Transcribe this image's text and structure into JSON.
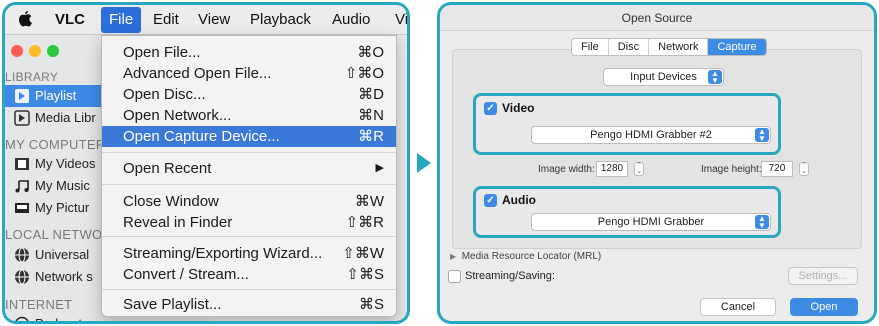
{
  "colors": {
    "accent": "#2aa7bf",
    "selection": "#3b79d9"
  },
  "menubar": {
    "items": [
      "VLC",
      "File",
      "Edit",
      "View",
      "Playback",
      "Audio",
      "Vi"
    ]
  },
  "sidebar": {
    "library_header": "LIBRARY",
    "playlist": "Playlist",
    "media_library": "Media Libr",
    "computer_header": "MY COMPUTER",
    "videos": "My Videos",
    "music": "My Music",
    "pictures": "My Pictur",
    "network_header": "LOCAL NETWO",
    "universal": "Universal",
    "network_s": "Network s",
    "internet_header": "INTERNET",
    "podcasts": "Podcasts"
  },
  "file_menu": {
    "items": [
      {
        "label": "Open File...",
        "shortcut": "⌘O"
      },
      {
        "label": "Advanced Open File...",
        "shortcut": "⇧⌘O"
      },
      {
        "label": "Open Disc...",
        "shortcut": "⌘D"
      },
      {
        "label": "Open Network...",
        "shortcut": "⌘N"
      },
      {
        "label": "Open Capture Device...",
        "shortcut": "⌘R"
      },
      {
        "label": "Open Recent",
        "shortcut": "▶"
      },
      {
        "label": "Close Window",
        "shortcut": "⌘W"
      },
      {
        "label": "Reveal in Finder",
        "shortcut": "⇧⌘R"
      },
      {
        "label": "Streaming/Exporting Wizard...",
        "shortcut": "⇧⌘W"
      },
      {
        "label": "Convert / Stream...",
        "shortcut": "⇧⌘S"
      },
      {
        "label": "Save Playlist...",
        "shortcut": "⌘S"
      }
    ]
  },
  "dialog": {
    "title": "Open Source",
    "tabs": [
      "File",
      "Disc",
      "Network",
      "Capture"
    ],
    "active_tab": "Capture",
    "source_type": "Input Devices",
    "video": {
      "label": "Video",
      "checked": true,
      "device": "Pengo HDMI Grabber #2"
    },
    "image_width_label": "Image width:",
    "image_width": "1280",
    "image_height_label": "Image height:",
    "image_height": "720",
    "audio": {
      "label": "Audio",
      "checked": true,
      "device": "Pengo HDMI Grabber"
    },
    "mrl_label": "Media Resource Locator (MRL)",
    "streaming_label": "Streaming/Saving:",
    "settings_button": "Settings...",
    "cancel_button": "Cancel",
    "open_button": "Open"
  }
}
